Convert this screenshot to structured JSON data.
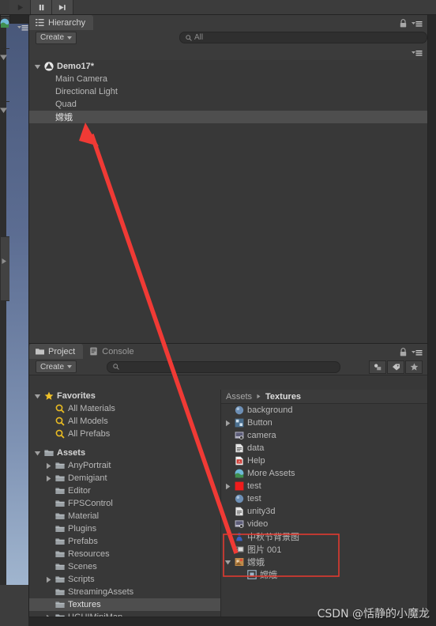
{
  "toolbar": {
    "play_label": "play-button",
    "pause_label": "pause-button",
    "step_label": "step-button"
  },
  "hierarchy": {
    "tab_label": "Hierarchy",
    "create_label": "Create",
    "search_placeholder": "All",
    "items": [
      {
        "label": "Demo17*",
        "depth": 0,
        "expanded": true,
        "selected": false,
        "icon": "unity-scene-icon"
      },
      {
        "label": "Main Camera",
        "depth": 1,
        "expanded": null,
        "selected": false,
        "icon": "none"
      },
      {
        "label": "Directional Light",
        "depth": 1,
        "expanded": null,
        "selected": false,
        "icon": "none"
      },
      {
        "label": "Quad",
        "depth": 1,
        "expanded": null,
        "selected": false,
        "icon": "none"
      },
      {
        "label": "嫦娥",
        "depth": 1,
        "expanded": null,
        "selected": true,
        "icon": "none"
      }
    ]
  },
  "project": {
    "tabs": [
      {
        "label": "Project",
        "icon": "folder-icon",
        "active": true
      },
      {
        "label": "Console",
        "icon": "console-icon",
        "active": false
      }
    ],
    "create_label": "Create",
    "search_placeholder": "",
    "filter_buttons": [
      {
        "name": "asset-type-filter-icon"
      },
      {
        "name": "label-filter-icon"
      },
      {
        "name": "favorite-filter-icon"
      }
    ],
    "tree": [
      {
        "label": "Favorites",
        "depth": 0,
        "icon": "star-icon",
        "arrow": "down",
        "selected": false,
        "bold": true
      },
      {
        "label": "All Materials",
        "depth": 1,
        "icon": "search-icon",
        "arrow": "none",
        "selected": false,
        "bold": false
      },
      {
        "label": "All Models",
        "depth": 1,
        "icon": "search-icon",
        "arrow": "none",
        "selected": false,
        "bold": false
      },
      {
        "label": "All Prefabs",
        "depth": 1,
        "icon": "search-icon",
        "arrow": "none",
        "selected": false,
        "bold": false
      },
      {
        "label": "",
        "depth": 0,
        "icon": "none",
        "arrow": "none",
        "selected": false,
        "bold": false
      },
      {
        "label": "Assets",
        "depth": 0,
        "icon": "folder-icon",
        "arrow": "down",
        "selected": false,
        "bold": true
      },
      {
        "label": "AnyPortrait",
        "depth": 1,
        "icon": "folder-icon",
        "arrow": "right",
        "selected": false,
        "bold": false
      },
      {
        "label": "Demigiant",
        "depth": 1,
        "icon": "folder-icon",
        "arrow": "right",
        "selected": false,
        "bold": false
      },
      {
        "label": "Editor",
        "depth": 1,
        "icon": "folder-icon",
        "arrow": "none",
        "selected": false,
        "bold": false
      },
      {
        "label": "FPSControl",
        "depth": 1,
        "icon": "folder-icon",
        "arrow": "none",
        "selected": false,
        "bold": false
      },
      {
        "label": "Material",
        "depth": 1,
        "icon": "folder-icon",
        "arrow": "none",
        "selected": false,
        "bold": false
      },
      {
        "label": "Plugins",
        "depth": 1,
        "icon": "folder-icon",
        "arrow": "none",
        "selected": false,
        "bold": false
      },
      {
        "label": "Prefabs",
        "depth": 1,
        "icon": "folder-icon",
        "arrow": "none",
        "selected": false,
        "bold": false
      },
      {
        "label": "Resources",
        "depth": 1,
        "icon": "folder-icon",
        "arrow": "none",
        "selected": false,
        "bold": false
      },
      {
        "label": "Scenes",
        "depth": 1,
        "icon": "folder-icon",
        "arrow": "none",
        "selected": false,
        "bold": false
      },
      {
        "label": "Scripts",
        "depth": 1,
        "icon": "folder-icon",
        "arrow": "right",
        "selected": false,
        "bold": false
      },
      {
        "label": "StreamingAssets",
        "depth": 1,
        "icon": "folder-icon",
        "arrow": "none",
        "selected": false,
        "bold": false
      },
      {
        "label": "Textures",
        "depth": 1,
        "icon": "folder-icon",
        "arrow": "none",
        "selected": true,
        "bold": false
      },
      {
        "label": "UGUIMiniMap",
        "depth": 1,
        "icon": "folder-icon",
        "arrow": "right",
        "selected": false,
        "bold": false
      }
    ],
    "breadcrumb": {
      "root": "Assets",
      "current": "Textures"
    },
    "assets": [
      {
        "label": "background",
        "depth": 0,
        "icon": "sphere-icon",
        "arrow": "none"
      },
      {
        "label": "Button",
        "depth": 0,
        "icon": "sprite-icon",
        "arrow": "right"
      },
      {
        "label": "camera",
        "depth": 0,
        "icon": "image-icon",
        "arrow": "none"
      },
      {
        "label": "data",
        "depth": 0,
        "icon": "text-icon",
        "arrow": "none"
      },
      {
        "label": "Help",
        "depth": 0,
        "icon": "pdf-icon",
        "arrow": "none"
      },
      {
        "label": "More Assets",
        "depth": 0,
        "icon": "globe-icon",
        "arrow": "none"
      },
      {
        "label": "test",
        "depth": 0,
        "icon": "red-tex-icon",
        "arrow": "right"
      },
      {
        "label": "test",
        "depth": 0,
        "icon": "sphere-icon",
        "arrow": "none"
      },
      {
        "label": "unity3d",
        "depth": 0,
        "icon": "text-icon",
        "arrow": "none"
      },
      {
        "label": "video",
        "depth": 0,
        "icon": "image-icon",
        "arrow": "none"
      },
      {
        "label": "中秋节背景图",
        "depth": 0,
        "icon": "person-icon",
        "arrow": "none"
      },
      {
        "label": "图片 001",
        "depth": 0,
        "icon": "film-icon",
        "arrow": "none"
      },
      {
        "label": "嫦娥",
        "depth": 0,
        "icon": "sprite-multi-icon",
        "arrow": "down"
      },
      {
        "label": "嫦娥",
        "depth": 1,
        "icon": "sprite-sub-icon",
        "arrow": "none"
      }
    ]
  },
  "annotations": {
    "arrow_color": "#f03a35",
    "box_color": "#e03a30",
    "watermark": "CSDN @恬静的小魔龙"
  }
}
